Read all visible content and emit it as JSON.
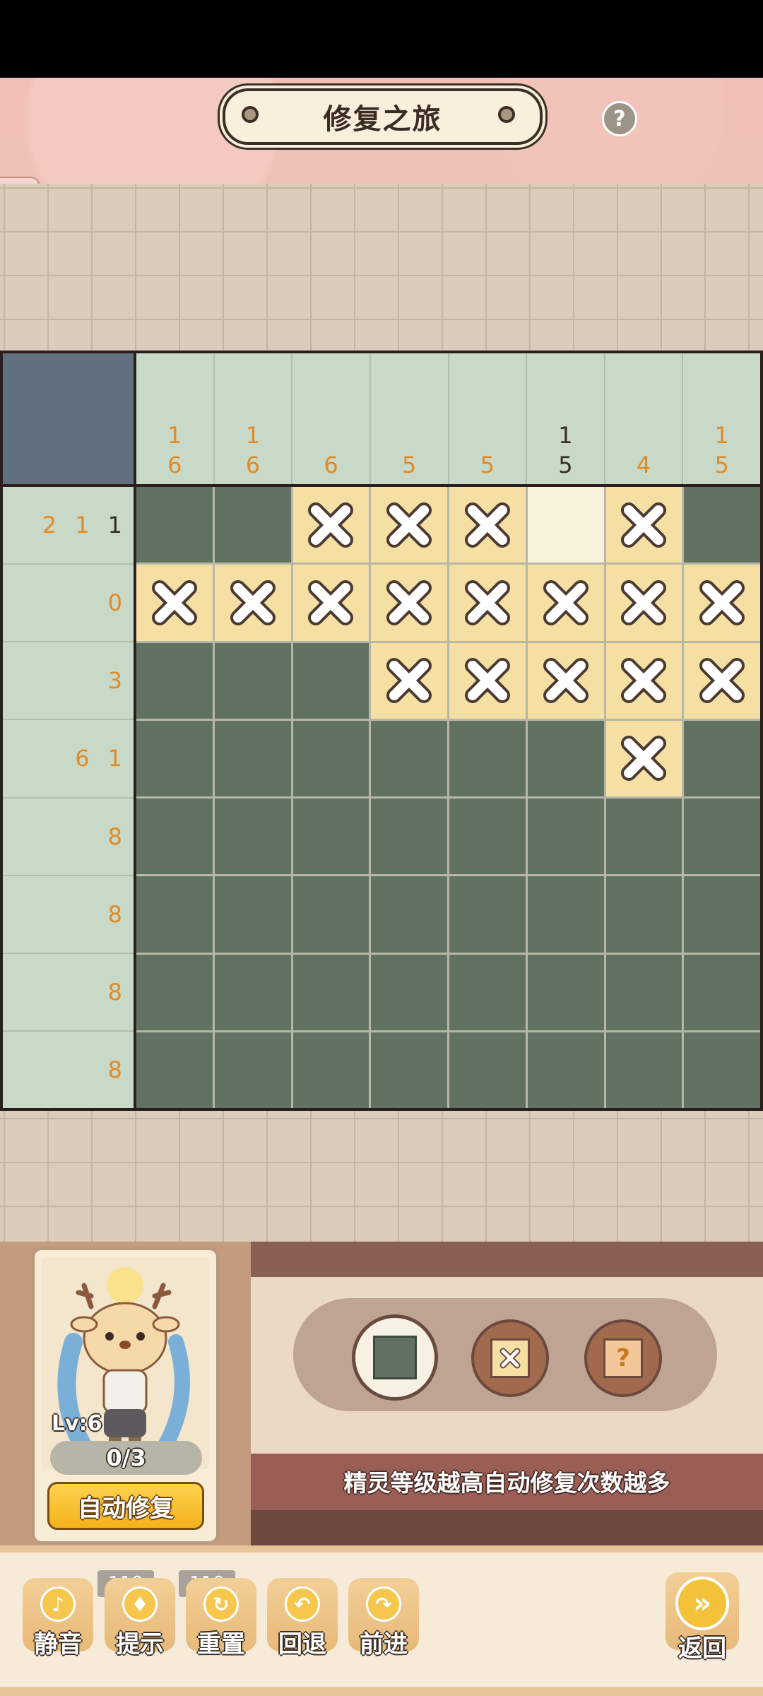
{
  "header": {
    "title": "修复之旅",
    "help_icon": "question-icon",
    "help_symbol": "?"
  },
  "puzzle": {
    "column_clues": [
      [
        "1",
        "6"
      ],
      [
        "1",
        "6"
      ],
      [
        "6"
      ],
      [
        "5"
      ],
      [
        "5"
      ],
      [
        "1",
        "5"
      ],
      [
        "4"
      ],
      [
        "1",
        "5"
      ]
    ],
    "column_clues_done": [
      [
        false,
        false
      ],
      [
        false,
        false
      ],
      [
        false
      ],
      [
        false
      ],
      [
        false
      ],
      [
        true,
        true
      ],
      [
        false
      ],
      [
        false,
        false
      ]
    ],
    "row_clues": [
      [
        "2",
        "1",
        "1"
      ],
      [
        "0"
      ],
      [
        "3"
      ],
      [
        "6",
        "1"
      ],
      [
        "8"
      ],
      [
        "8"
      ],
      [
        "8"
      ],
      [
        "8"
      ]
    ],
    "row_clues_done": [
      [
        false,
        false,
        true
      ],
      [
        false
      ],
      [
        false
      ],
      [
        false,
        false
      ],
      [
        false
      ],
      [
        false
      ],
      [
        false
      ],
      [
        false
      ]
    ],
    "grid": [
      [
        "F",
        "F",
        "X",
        "X",
        "X",
        "E",
        "X",
        "F"
      ],
      [
        "X",
        "X",
        "X",
        "X",
        "X",
        "X",
        "X",
        "X"
      ],
      [
        "F",
        "F",
        "F",
        "X",
        "X",
        "X",
        "X",
        "X"
      ],
      [
        "F",
        "F",
        "F",
        "F",
        "F",
        "F",
        "X",
        "F"
      ],
      [
        "F",
        "F",
        "F",
        "F",
        "F",
        "F",
        "F",
        "F"
      ],
      [
        "F",
        "F",
        "F",
        "F",
        "F",
        "F",
        "F",
        "F"
      ],
      [
        "F",
        "F",
        "F",
        "F",
        "F",
        "F",
        "F",
        "F"
      ],
      [
        "F",
        "F",
        "F",
        "F",
        "F",
        "F",
        "F",
        "F"
      ]
    ],
    "colors": {
      "filled": "#627262",
      "crossed": "#f6dfa3",
      "clue": "#e28a25",
      "clue_done": "#3a2c24"
    }
  },
  "sprite": {
    "level": "Lv:6",
    "auto_count": "0/3",
    "auto_button": "自动修复"
  },
  "modes": {
    "selected": "fill",
    "hint": "精灵等级越高自动修复次数越多",
    "unknown_symbol": "?"
  },
  "toolbar": {
    "mute": "静音",
    "hint": "提示",
    "hint_count": "119",
    "reset": "重置",
    "reset_count": "110",
    "undo": "回退",
    "redo": "前进",
    "back": "返回"
  }
}
